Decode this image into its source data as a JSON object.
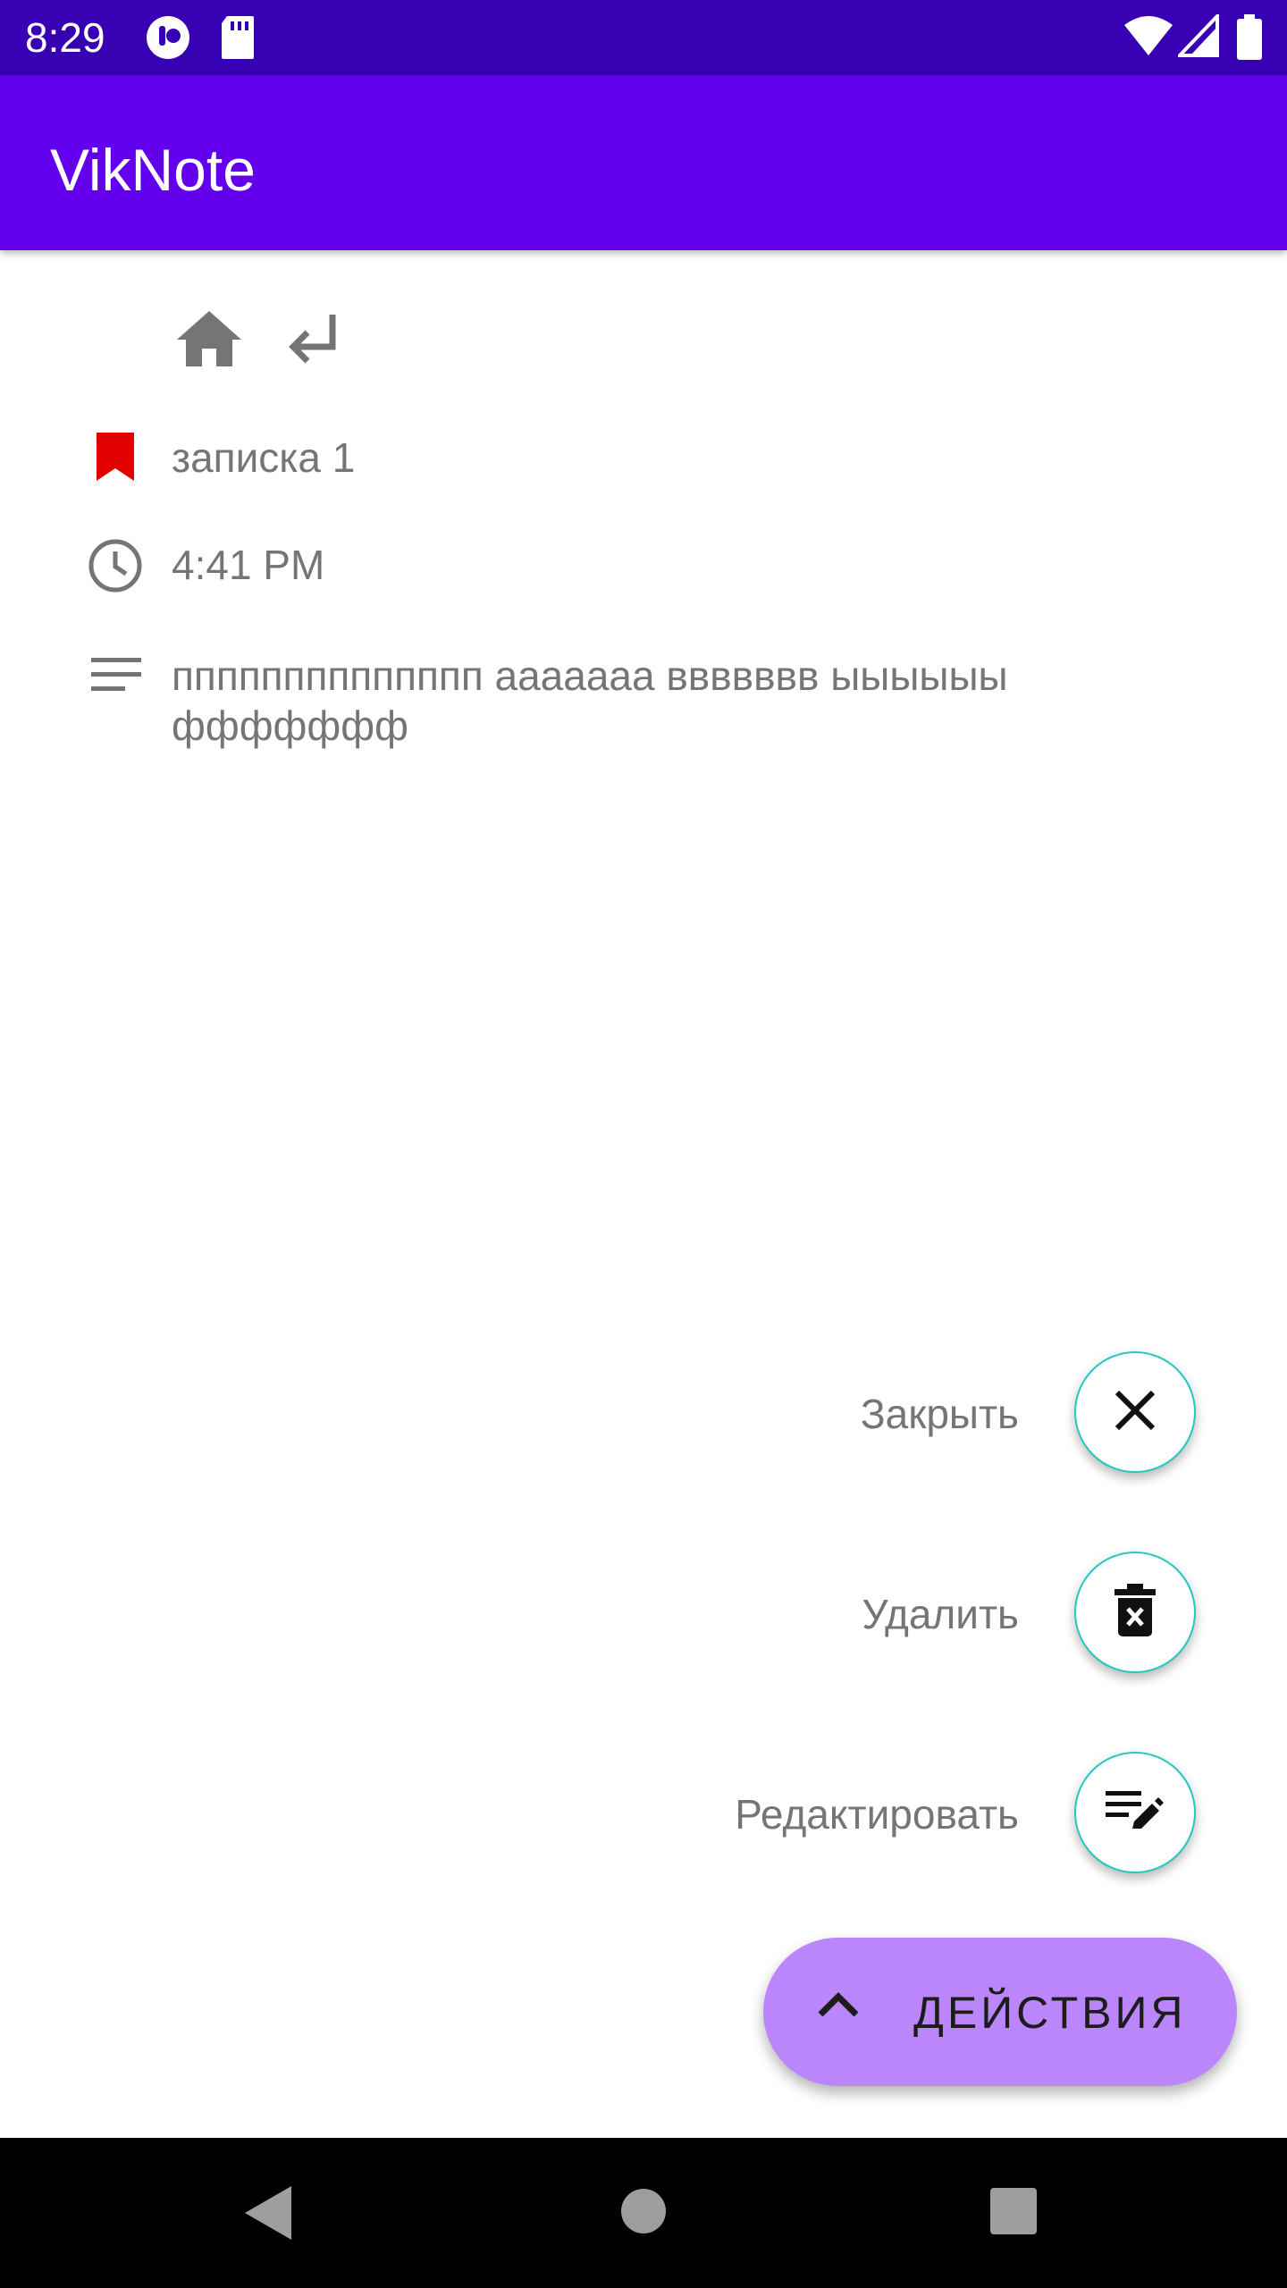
{
  "status_bar": {
    "time": "8:29",
    "icons": [
      "media-icon",
      "sd-card-icon",
      "wifi-icon",
      "signal-icon",
      "battery-icon"
    ]
  },
  "app_bar": {
    "title": "VikNote",
    "color": "#6200ee",
    "status_color": "#3700b3"
  },
  "toolbar": {
    "icons": [
      "home-icon",
      "return-icon"
    ]
  },
  "note": {
    "title": "записка 1",
    "time": "4:41 PM",
    "body": "пппппппппппппп ааааааа ввввввв ыыыыыы ффффффф",
    "bookmark_color": "#e00000"
  },
  "actions": {
    "close_label": "Закрыть",
    "delete_label": "Удалить",
    "edit_label": "Редактировать",
    "main_label": "ДЕЙСТВИЯ",
    "accent_color": "#bb86fc",
    "mini_border_color": "#26c6c1"
  },
  "nav_bar": {
    "icons": [
      "back-icon",
      "home-circle-icon",
      "recents-icon"
    ]
  }
}
